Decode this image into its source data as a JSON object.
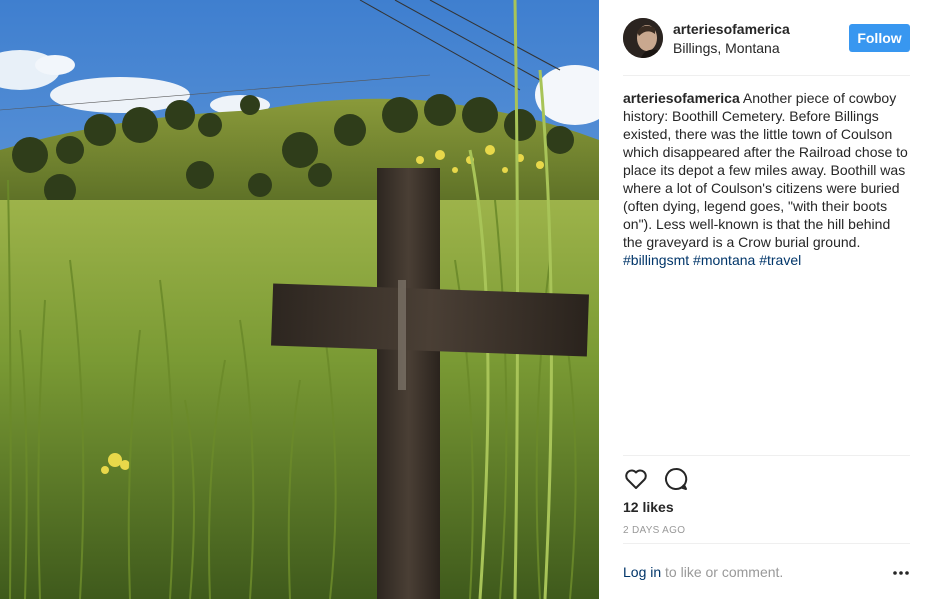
{
  "post": {
    "username": "arteriesofamerica",
    "location": "Billings, Montana",
    "follow_label": "Follow",
    "caption_user": "arteriesofamerica",
    "caption_text": "Another piece of cowboy history: Boothill Cemetery. Before Billings existed, there was the little town of Coulson which disappeared after the Railroad chose to place its depot a few miles away. Boothill was where a lot of Coulson's citizens were buried (often dying, legend goes, \"with their boots on\"). Less well-known is that the hill behind the graveyard is a Crow burial ground.",
    "hashtags": [
      "#billingsmt",
      "#montana",
      "#travel"
    ],
    "likes": "12 likes",
    "timestamp": "2 DAYS AGO",
    "login_link": "Log in",
    "login_suffix": " to like or comment."
  },
  "icons": {
    "like": "heart-outline-icon",
    "comment": "speech-bubble-icon",
    "more": "ellipsis-icon"
  },
  "colors": {
    "accent": "#3897f0",
    "hashtag": "#003569",
    "muted": "#999999",
    "divider": "#efefef"
  }
}
